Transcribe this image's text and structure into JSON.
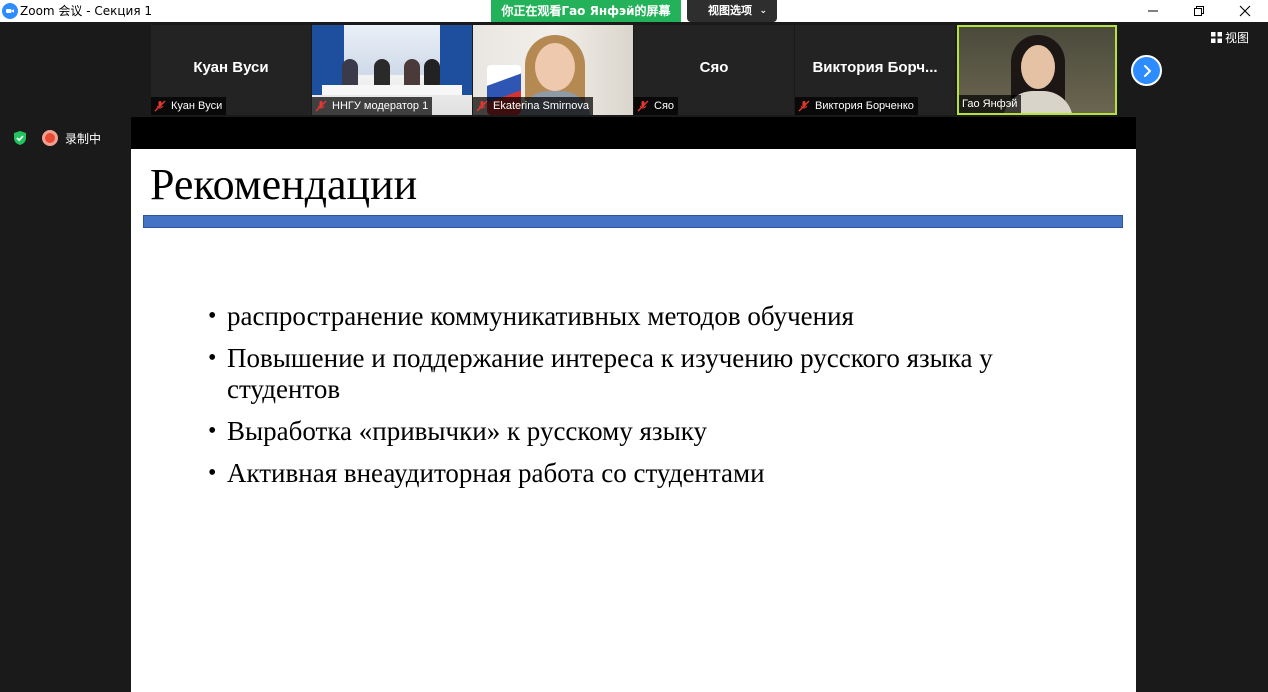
{
  "window": {
    "title": "Zoom 会议 - Секция 1",
    "viewing_banner": "你正在观看Гао Янфэй的屏幕",
    "view_options_label": "视图选项"
  },
  "gallery": {
    "view_label": "视图",
    "tiles": [
      {
        "display_name": "Куан Вуси",
        "label": "Куан Вуси",
        "muted": true,
        "video": false
      },
      {
        "display_name": "",
        "label": "ННГУ модератор 1",
        "muted": true,
        "video": true
      },
      {
        "display_name": "",
        "label": "Ekaterina Smirnova",
        "muted": true,
        "video": true
      },
      {
        "display_name": "Сяо",
        "label": "Сяо",
        "muted": true,
        "video": false
      },
      {
        "display_name": "Виктория Борч...",
        "label": "Виктория Борченко",
        "muted": true,
        "video": false
      },
      {
        "display_name": "",
        "label": "Гао Янфэй",
        "muted": false,
        "video": true,
        "active_speaker": true
      }
    ]
  },
  "status": {
    "recording_label": "录制中"
  },
  "slide": {
    "title": "Рекомендации",
    "bullets": [
      "распространение коммуникативных методов обучения",
      "Повышение и поддержание интереса к изучению русского языка у студентов",
      "Выработка «привычки» к русскому языку",
      "Активная внеаудиторная работа со студентами"
    ]
  },
  "colors": {
    "zoom_blue": "#2d8cff",
    "banner_green": "#23b25a",
    "slide_rule": "#4472c4",
    "active_border": "#b6e33a",
    "recording_red": "#e84a36"
  },
  "icons": {
    "mute": "mic-muted-icon",
    "next": "chevron-right-icon",
    "view": "grid-icon",
    "security": "shield-check-icon"
  }
}
